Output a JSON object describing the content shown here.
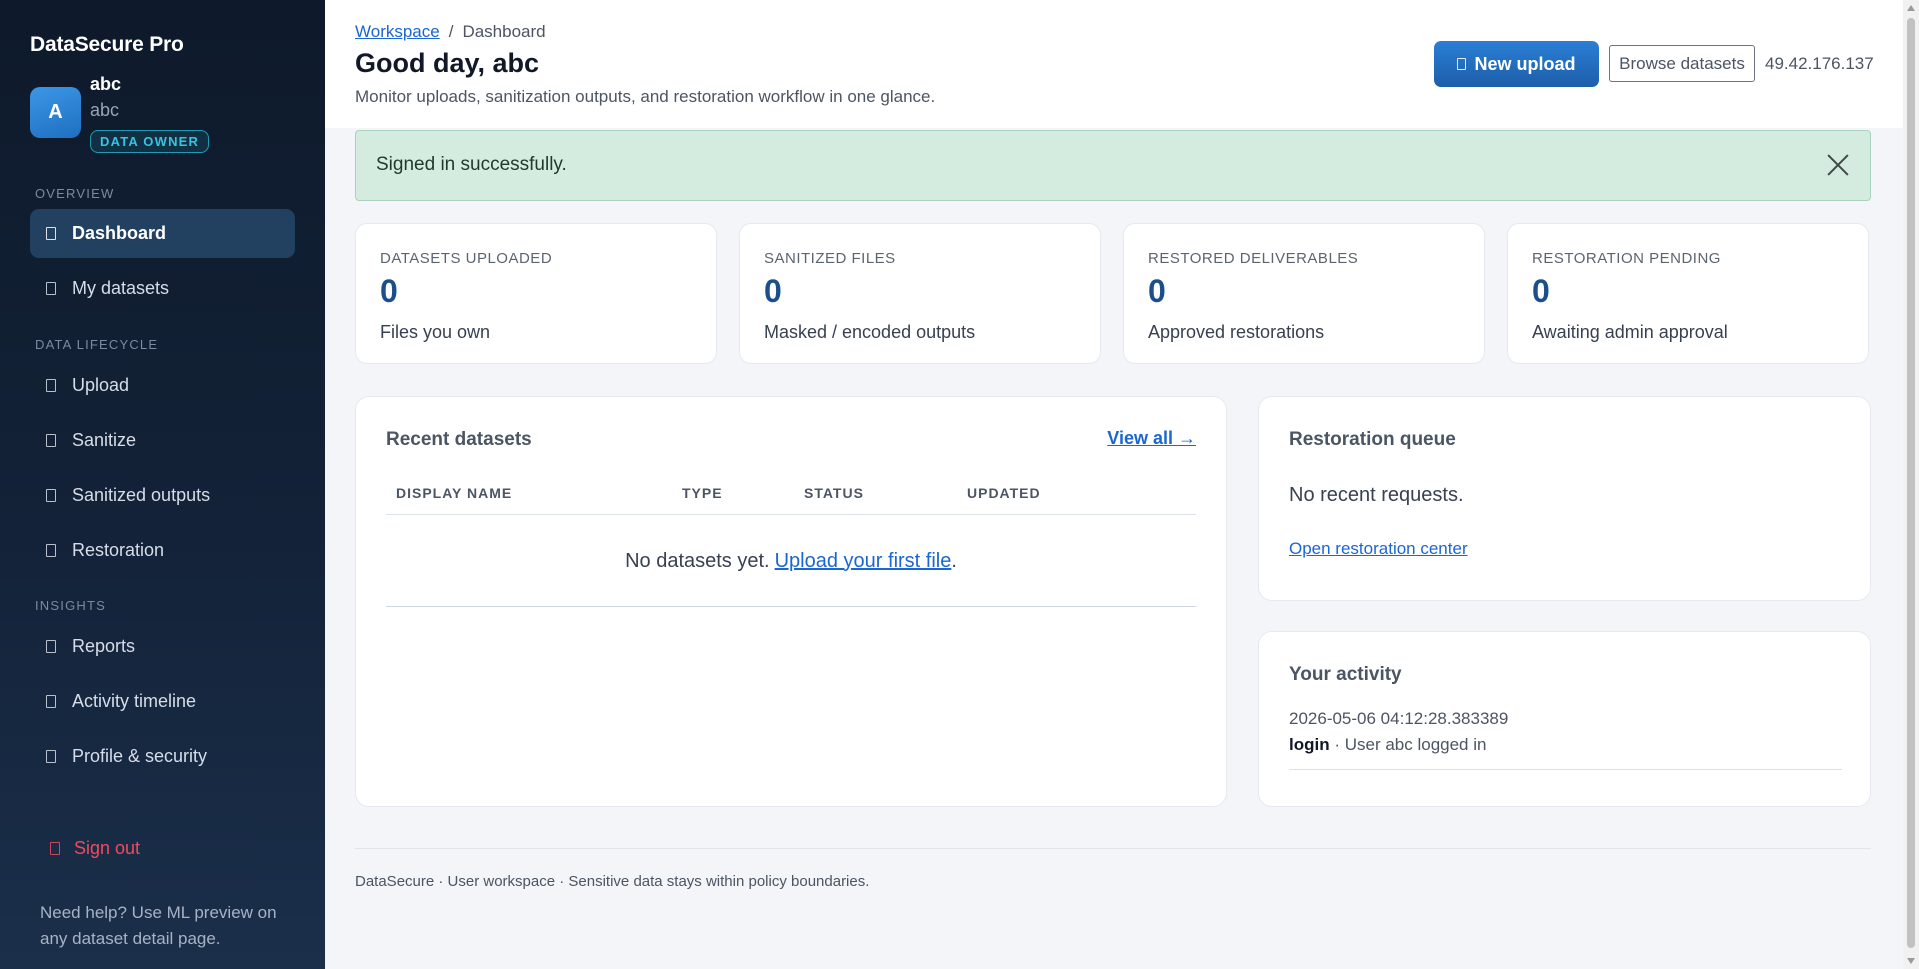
{
  "sidebar": {
    "brand": "DataSecure Pro",
    "user": {
      "avatar_initial": "A",
      "name": "abc",
      "handle": "abc",
      "role": "DATA OWNER"
    },
    "sections": [
      {
        "title": "OVERVIEW",
        "items": [
          {
            "label": "Dashboard",
            "icon": "dashboard-icon",
            "active": true
          },
          {
            "label": "My datasets",
            "icon": "datasets-icon",
            "active": false
          }
        ]
      },
      {
        "title": "DATA LIFECYCLE",
        "items": [
          {
            "label": "Upload",
            "icon": "upload-icon",
            "active": false
          },
          {
            "label": "Sanitize",
            "icon": "sanitize-icon",
            "active": false
          },
          {
            "label": "Sanitized outputs",
            "icon": "outputs-icon",
            "active": false
          },
          {
            "label": "Restoration",
            "icon": "restoration-icon",
            "active": false
          }
        ]
      },
      {
        "title": "INSIGHTS",
        "items": [
          {
            "label": "Reports",
            "icon": "reports-icon",
            "active": false
          },
          {
            "label": "Activity timeline",
            "icon": "timeline-icon",
            "active": false
          },
          {
            "label": "Profile & security",
            "icon": "shield-icon",
            "active": false
          }
        ]
      }
    ],
    "signout_label": "Sign out",
    "help_text": "Need help? Use ML preview on any dataset detail page."
  },
  "header": {
    "breadcrumb": {
      "parent": "Workspace",
      "separator": "/",
      "current": "Dashboard"
    },
    "title": "Good day, abc",
    "subtitle": "Monitor uploads, sanitization outputs, and restoration workflow in one glance.",
    "new_upload_label": "New upload",
    "browse_label": "Browse datasets",
    "ip_address": "49.42.176.137"
  },
  "alert": {
    "message": "Signed in successfully."
  },
  "stats": [
    {
      "label": "DATASETS UPLOADED",
      "value": "0",
      "desc": "Files you own"
    },
    {
      "label": "SANITIZED FILES",
      "value": "0",
      "desc": "Masked / encoded outputs"
    },
    {
      "label": "RESTORED DELIVERABLES",
      "value": "0",
      "desc": "Approved restorations"
    },
    {
      "label": "RESTORATION PENDING",
      "value": "0",
      "desc": "Awaiting admin approval"
    }
  ],
  "recent": {
    "title": "Recent datasets",
    "view_all": "View all →",
    "columns": [
      "DISPLAY NAME",
      "TYPE",
      "STATUS",
      "UPDATED"
    ],
    "empty_text": "No datasets yet.",
    "empty_link": "Upload your first file",
    "empty_suffix": "."
  },
  "restoration_queue": {
    "title": "Restoration queue",
    "empty_text": "No recent requests.",
    "link": "Open restoration center"
  },
  "activity": {
    "title": "Your activity",
    "entries": [
      {
        "timestamp": "2026-05-06 04:12:28.383389",
        "action": "login",
        "separator": " · ",
        "detail": "User abc logged in"
      }
    ]
  },
  "footer": {
    "text": "DataSecure · User workspace · Sensitive data stays within policy boundaries."
  },
  "colors": {
    "sidebar_bg": "#0e1a2b",
    "accent_blue": "#2a7fd6",
    "stat_value": "#1c4e8c",
    "alert_bg": "#d4ebe0",
    "signout": "#ef4b5f",
    "role_badge": "#38c3e0"
  }
}
